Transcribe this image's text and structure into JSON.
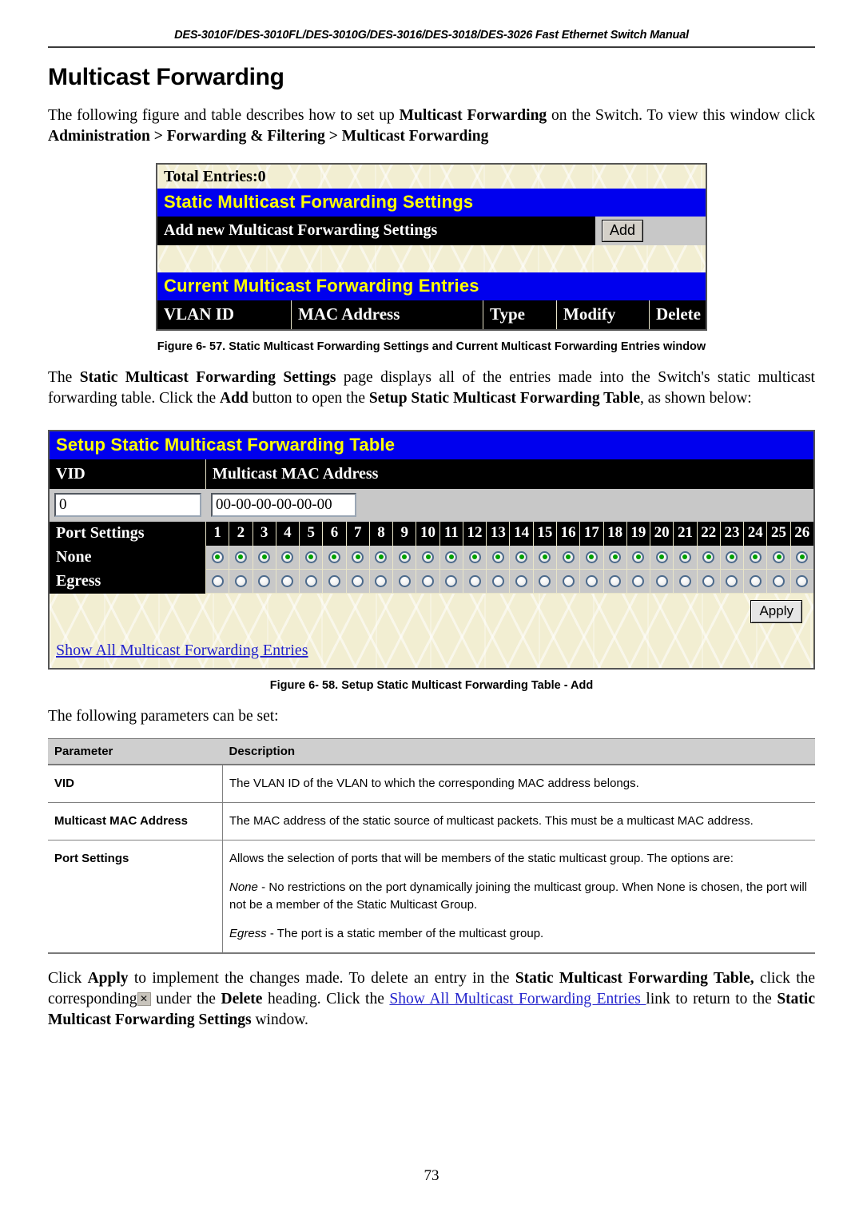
{
  "header": {
    "running_title": "DES-3010F/DES-3010FL/DES-3010G/DES-3016/DES-3018/DES-3026 Fast Ethernet Switch Manual",
    "page_title": "Multicast Forwarding",
    "page_number": "73"
  },
  "intro": {
    "p1_a": "The following figure and table describes how to set up ",
    "p1_b": "Multicast Forwarding",
    "p1_c": " on the Switch. To view this window click ",
    "p1_d": "Administration > Forwarding & Filtering > Multicast Forwarding"
  },
  "figure1": {
    "total_entries": "Total Entries:0",
    "settings_bar": "Static Multicast Forwarding Settings",
    "add_row_label": "Add new Multicast Forwarding Settings",
    "add_button": "Add",
    "entries_bar": "Current Multicast Forwarding Entries",
    "columns": [
      "VLAN ID",
      "MAC Address",
      "Type",
      "Modify",
      "Delete"
    ],
    "caption": "Figure 6- 57. Static Multicast Forwarding Settings and Current Multicast Forwarding Entries window"
  },
  "between": {
    "a": "The ",
    "b": "Static Multicast Forwarding Settings",
    "c": " page displays all of the entries made into the Switch's static multicast forwarding table. Click the ",
    "d": "Add",
    "e": " button to open the ",
    "f": "Setup Static Multicast Forwarding Table",
    "g": ", as shown below:"
  },
  "figure2": {
    "title_bar": "Setup Static Multicast Forwarding Table",
    "col_vid": "VID",
    "col_mac": "Multicast MAC Address",
    "vid_value": "0",
    "mac_value": "00-00-00-00-00-00",
    "port_settings_label": "Port Settings",
    "ports": [
      "1",
      "2",
      "3",
      "4",
      "5",
      "6",
      "7",
      "8",
      "9",
      "10",
      "11",
      "12",
      "13",
      "14",
      "15",
      "16",
      "17",
      "18",
      "19",
      "20",
      "21",
      "22",
      "23",
      "24",
      "25",
      "26"
    ],
    "row_none_label": "None",
    "row_egress_label": "Egress",
    "none_selected": [
      true,
      true,
      true,
      true,
      true,
      true,
      true,
      true,
      true,
      true,
      true,
      true,
      true,
      true,
      true,
      true,
      true,
      true,
      true,
      true,
      true,
      true,
      true,
      true,
      true,
      true
    ],
    "egress_selected": [
      false,
      false,
      false,
      false,
      false,
      false,
      false,
      false,
      false,
      false,
      false,
      false,
      false,
      false,
      false,
      false,
      false,
      false,
      false,
      false,
      false,
      false,
      false,
      false,
      false,
      false
    ],
    "apply_button": "Apply",
    "show_all_link": "Show All Multicast Forwarding Entries",
    "caption": "Figure 6- 58. Setup Static Multicast Forwarding Table - Add"
  },
  "params_intro": "The following parameters can be set:",
  "params_table": {
    "headers": [
      "Parameter",
      "Description"
    ],
    "rows": [
      {
        "parameter": "VID",
        "description": [
          "The VLAN ID of the VLAN to which the corresponding MAC address belongs."
        ]
      },
      {
        "parameter": "Multicast MAC Address",
        "description": [
          "The MAC address of the static source of multicast packets. This must be a multicast MAC address."
        ]
      },
      {
        "parameter": "Port Settings",
        "description": [
          "Allows the selection of ports that will be members of the static multicast group. The options are:",
          "None - No restrictions on the port dynamically joining the multicast group. When None is chosen, the port will not be a member of the Static Multicast Group.",
          "Egress - The port is a static member of the multicast group."
        ],
        "italic_leads": [
          "",
          "None",
          "Egress"
        ]
      }
    ]
  },
  "closing": {
    "a": "Click ",
    "b": "Apply",
    "c": " to implement the changes made. To delete an entry in the ",
    "d": "Static Multicast Forwarding Table,",
    "e": " click the corresponding",
    "x_icon": "✕",
    "f": " under the ",
    "g": "Delete",
    "h": " heading. Click the ",
    "link": "Show All Multicast Forwarding Entries ",
    "i": "link to return to the ",
    "j": "Static Multicast Forwarding Settings",
    "k": " window."
  }
}
